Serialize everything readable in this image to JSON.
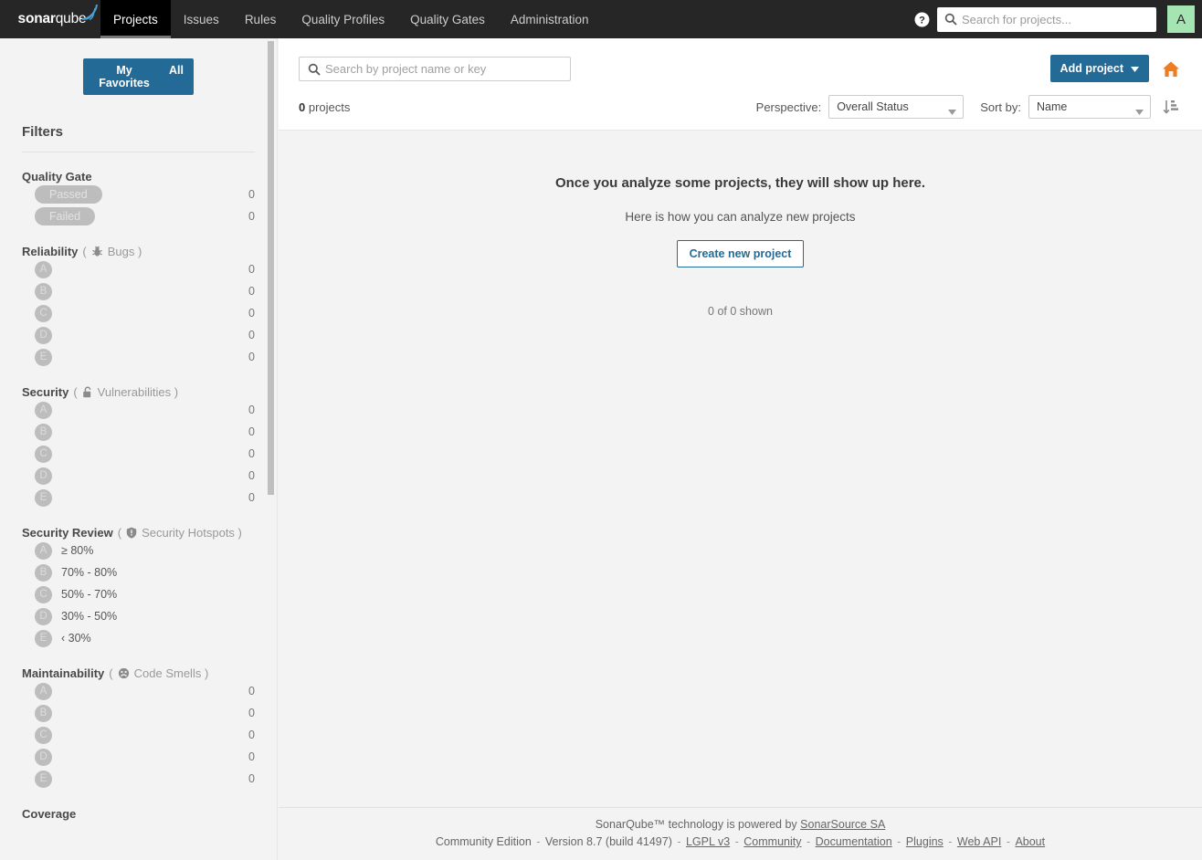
{
  "navbar": {
    "logo": {
      "bold": "sonar",
      "light": "qube",
      "icon": "sonarqube-logo"
    },
    "items": [
      {
        "label": "Projects",
        "active": true
      },
      {
        "label": "Issues",
        "active": false
      },
      {
        "label": "Rules",
        "active": false
      },
      {
        "label": "Quality Profiles",
        "active": false
      },
      {
        "label": "Quality Gates",
        "active": false
      },
      {
        "label": "Administration",
        "active": false
      }
    ],
    "help_icon": "help-icon",
    "search": {
      "placeholder": "Search for projects...",
      "value": "",
      "icon": "search-icon"
    },
    "avatar": {
      "initial": "A",
      "color": "#a5e5b4"
    }
  },
  "sidebar": {
    "toggle": {
      "favorites_label": "My Favorites",
      "all_label": "All",
      "active": "My Favorites",
      "color": "#236a96"
    },
    "filters_title": "Filters",
    "facets": [
      {
        "name": "quality-gate",
        "title": "Quality Gate",
        "sub": null,
        "rows": [
          {
            "kind": "pill",
            "label": "Passed",
            "count": "0"
          },
          {
            "kind": "pill",
            "label": "Failed",
            "count": "0"
          }
        ]
      },
      {
        "name": "reliability",
        "title": "Reliability",
        "sub": {
          "icon": "bug-icon",
          "label": "Bugs"
        },
        "rows": [
          {
            "kind": "rating",
            "label": "A",
            "count": "0"
          },
          {
            "kind": "rating",
            "label": "B",
            "count": "0"
          },
          {
            "kind": "rating",
            "label": "C",
            "count": "0"
          },
          {
            "kind": "rating",
            "label": "D",
            "count": "0"
          },
          {
            "kind": "rating",
            "label": "E",
            "count": "0"
          }
        ]
      },
      {
        "name": "security",
        "title": "Security",
        "sub": {
          "icon": "vulnerability-lock-icon",
          "label": "Vulnerabilities"
        },
        "rows": [
          {
            "kind": "rating",
            "label": "A",
            "count": "0"
          },
          {
            "kind": "rating",
            "label": "B",
            "count": "0"
          },
          {
            "kind": "rating",
            "label": "C",
            "count": "0"
          },
          {
            "kind": "rating",
            "label": "D",
            "count": "0"
          },
          {
            "kind": "rating",
            "label": "E",
            "count": "0"
          }
        ]
      },
      {
        "name": "security-review",
        "title": "Security Review",
        "sub": {
          "icon": "security-hotspot-shield-icon",
          "label": "Security Hotspots"
        },
        "rows": [
          {
            "kind": "rating",
            "label": "A",
            "text": "≥ 80%",
            "count": ""
          },
          {
            "kind": "rating",
            "label": "B",
            "text": "70% - 80%",
            "count": ""
          },
          {
            "kind": "rating",
            "label": "C",
            "text": "50% - 70%",
            "count": ""
          },
          {
            "kind": "rating",
            "label": "D",
            "text": "30% - 50%",
            "count": ""
          },
          {
            "kind": "rating",
            "label": "E",
            "text": "‹ 30%",
            "count": ""
          }
        ]
      },
      {
        "name": "maintainability",
        "title": "Maintainability",
        "sub": {
          "icon": "code-smell-icon",
          "label": "Code Smells"
        },
        "rows": [
          {
            "kind": "rating",
            "label": "A",
            "count": "0"
          },
          {
            "kind": "rating",
            "label": "B",
            "count": "0"
          },
          {
            "kind": "rating",
            "label": "C",
            "count": "0"
          },
          {
            "kind": "rating",
            "label": "D",
            "count": "0"
          },
          {
            "kind": "rating",
            "label": "E",
            "count": "0"
          }
        ]
      },
      {
        "name": "coverage",
        "title": "Coverage",
        "sub": null,
        "rows": []
      }
    ]
  },
  "main": {
    "search": {
      "placeholder": "Search by project name or key",
      "value": "",
      "icon": "search-icon"
    },
    "add_project_label": "Add project",
    "home_icon": "home-icon",
    "count_number": "0",
    "count_word": "projects",
    "perspective_label": "Perspective:",
    "perspective_value": "Overall Status",
    "sort_label": "Sort by:",
    "sort_value": "Name",
    "sort_direction_icon": "sort-ascending-icon",
    "empty_title": "Once you analyze some projects, they will show up here.",
    "empty_sub": "Here is how you can analyze new projects",
    "create_button_label": "Create new project",
    "shown_label": "0 of 0 shown"
  },
  "footer": {
    "line1_prefix": "SonarQube™ technology is powered by ",
    "line1_link": "SonarSource SA",
    "edition": "Community Edition",
    "version": "Version 8.7 (build 41497)",
    "links": [
      "LGPL v3",
      "Community",
      "Documentation",
      "Plugins",
      "Web API",
      "About"
    ]
  }
}
